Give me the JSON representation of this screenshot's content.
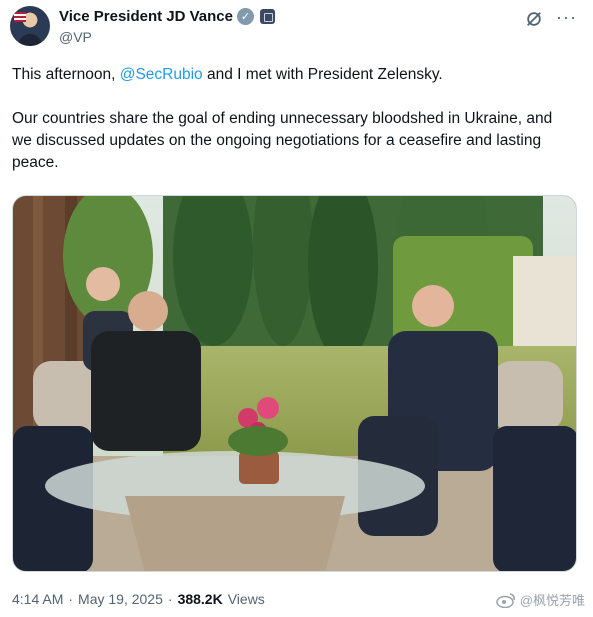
{
  "header": {
    "display_name": "Vice President JD Vance",
    "handle": "@VP",
    "verified_icon": "verified-badge",
    "affiliate_icon": "government-badge",
    "grok_icon": "grok-icon",
    "more_icon": "more-icon"
  },
  "tweet": {
    "line1_prefix": "This afternoon, ",
    "mention": "@SecRubio",
    "line1_suffix": " and I met with President Zelensky.",
    "paragraph2": "Our countries share the goal of ending unnecessary bloodshed in Ukraine, and we discussed updates on the ongoing negotiations for a ceasefire and lasting peace."
  },
  "meta": {
    "time": "4:14 AM",
    "separator1": "·",
    "date": "May 19, 2025",
    "separator2": "·",
    "views_count": "388.2K",
    "views_label": "Views"
  },
  "watermark": {
    "text": "@枫悦芳唯",
    "icon": "weibo-icon"
  },
  "colors": {
    "link": "#1d9bf0",
    "secondary_text": "#536471",
    "primary_text": "#0f1419"
  }
}
